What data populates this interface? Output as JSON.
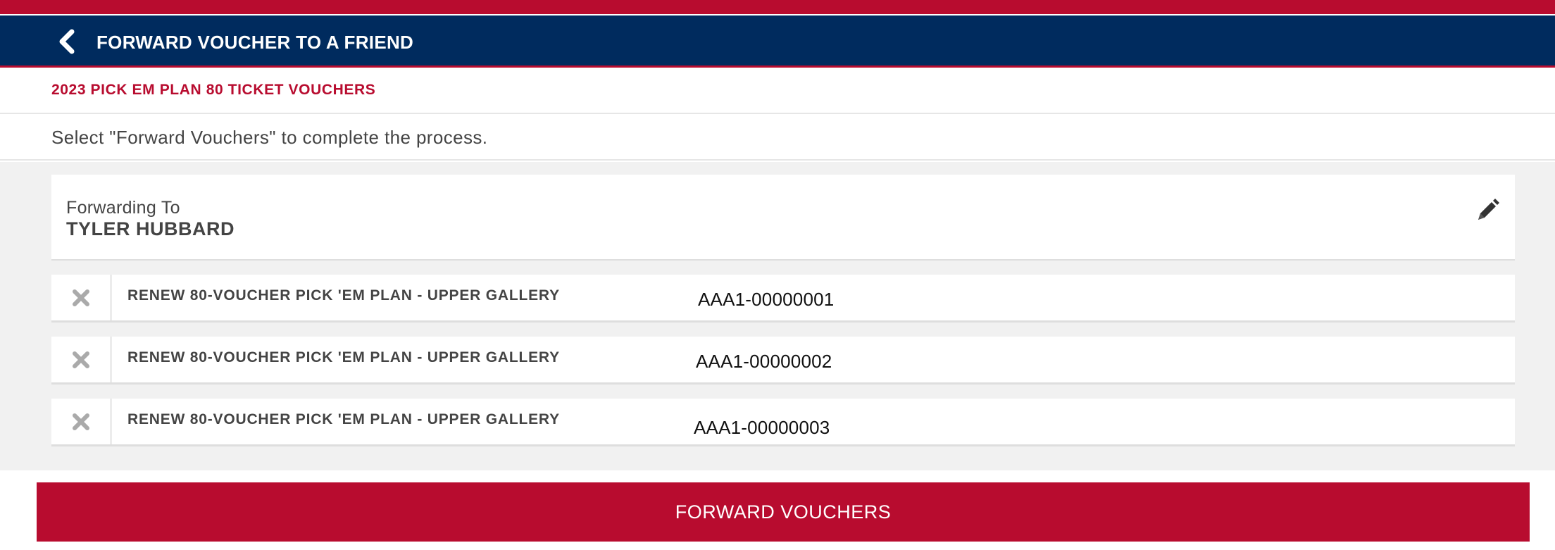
{
  "header": {
    "title": "FORWARD VOUCHER TO A FRIEND",
    "back_icon": "chevron-left-icon"
  },
  "subtitle": "2023 PICK EM PLAN 80 TICKET VOUCHERS",
  "instruction": "Select \"Forward Vouchers\" to complete the process.",
  "forwarding": {
    "label": "Forwarding To",
    "name": "TYLER HUBBARD",
    "edit_icon": "pencil-icon"
  },
  "vouchers": [
    {
      "name": "RENEW 80-VOUCHER PICK 'EM PLAN - UPPER GALLERY",
      "code": "AAA1-00000001"
    },
    {
      "name": "RENEW 80-VOUCHER PICK 'EM PLAN - UPPER GALLERY",
      "code": "AAA1-00000002"
    },
    {
      "name": "RENEW 80-VOUCHER PICK 'EM PLAN - UPPER GALLERY",
      "code": "AAA1-00000003"
    }
  ],
  "submit_label": "FORWARD VOUCHERS",
  "colors": {
    "brand_red": "#b80c2f",
    "brand_navy": "#002b5e",
    "background_gray": "#f1f1f1"
  }
}
